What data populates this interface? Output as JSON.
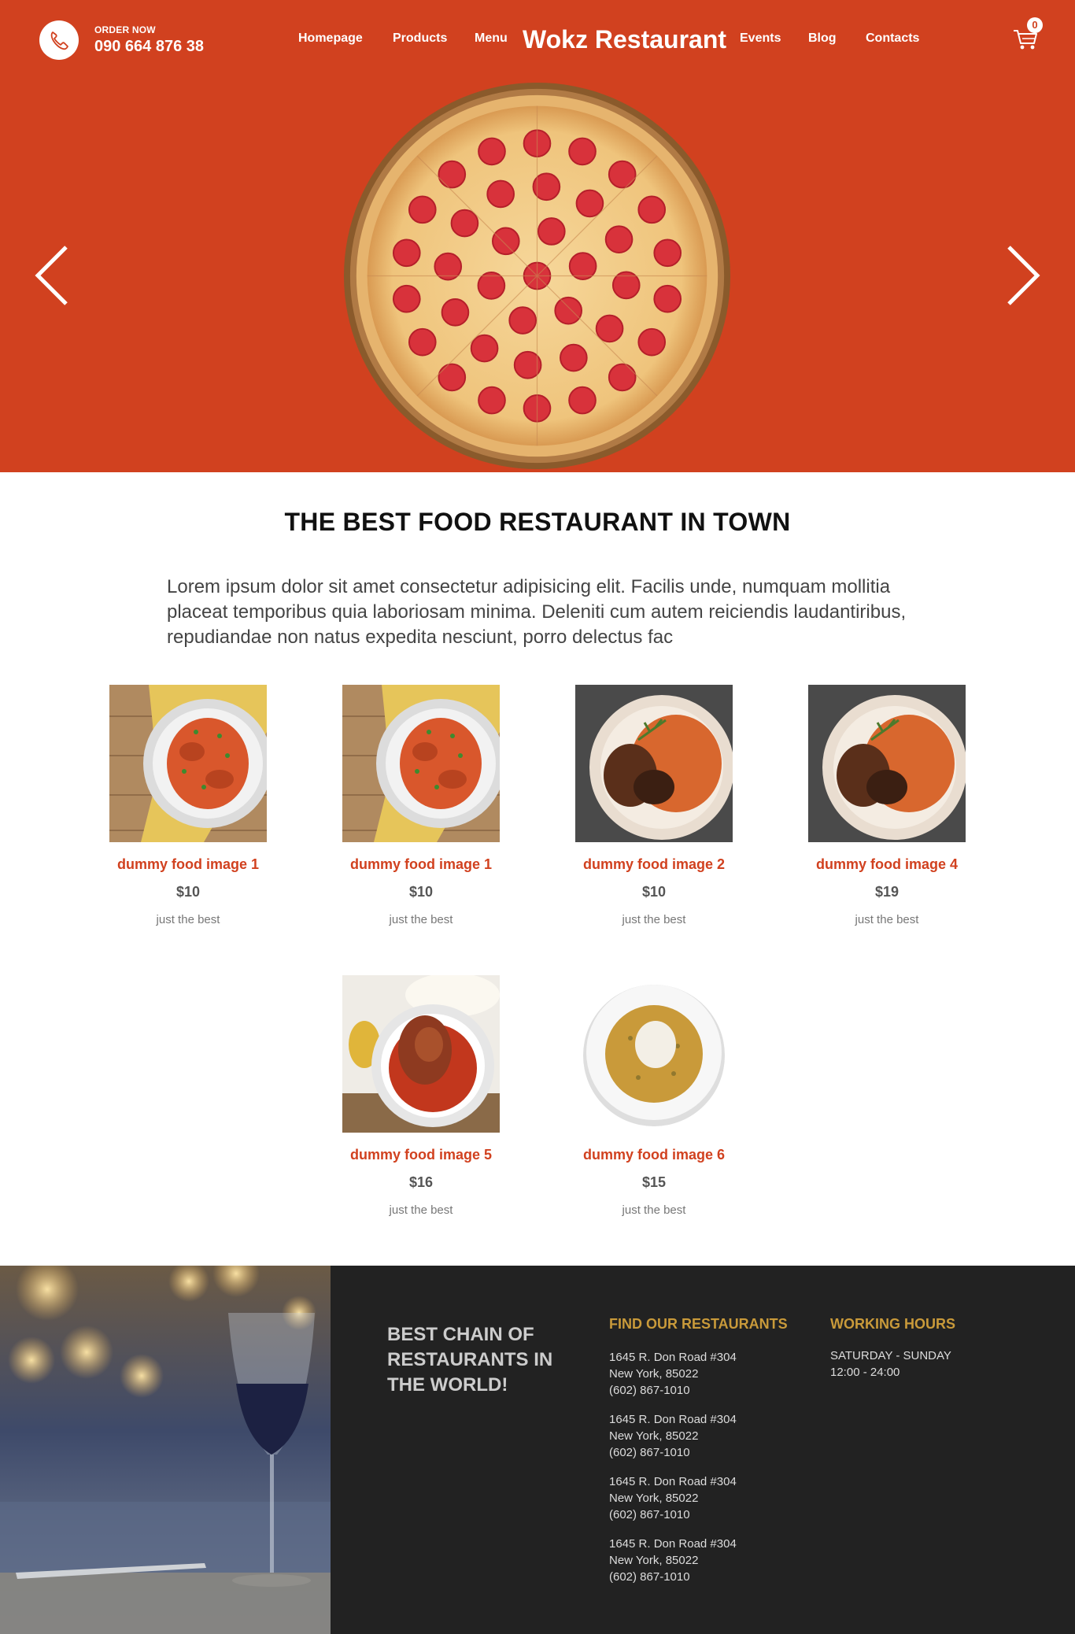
{
  "header": {
    "order_label": "ORDER NOW",
    "phone": "090 664 876 38",
    "brand": "Wokz Restaurant",
    "nav": [
      "Homepage",
      "Products",
      "Menu",
      "Events",
      "Blog",
      "Contacts"
    ],
    "cart_count": "0",
    "accent_color": "#d1411f"
  },
  "hero": {
    "image": "pepperoni-pizza",
    "prev_icon": "chevron-left-icon",
    "next_icon": "chevron-right-icon"
  },
  "intro": {
    "title": "THE BEST FOOD RESTAURANT IN TOWN",
    "text": "Lorem ipsum dolor sit amet consectetur adipisicing elit. Facilis unde, numquam mollitia placeat temporibus quia laboriosam minima. Deleniti cum autem reiciendis laudantiribus, repudiandae non natus expedita nesciunt, porro delectus fac"
  },
  "products": [
    {
      "name": "dummy food image 1",
      "price": "$10",
      "tag": "just the best",
      "image": "pasta-chicken-plate"
    },
    {
      "name": "dummy food image 1",
      "price": "$10",
      "tag": "just the best",
      "image": "pasta-chicken-plate"
    },
    {
      "name": "dummy food image 2",
      "price": "$10",
      "tag": "just the best",
      "image": "jollof-rice-chicken-bowl"
    },
    {
      "name": "dummy food image 4",
      "price": "$19",
      "tag": "just the best",
      "image": "jollof-rice-chicken-bowl"
    },
    {
      "name": "dummy food image 5",
      "price": "$16",
      "tag": "just the best",
      "image": "chicken-stew-bowl"
    },
    {
      "name": "dummy food image 6",
      "price": "$15",
      "tag": "just the best",
      "image": "egusi-soup-plate"
    }
  ],
  "footer": {
    "tagline": "BEST CHAIN OF RESTAURANTS IN THE WORLD!",
    "find_title": "FIND OUR RESTAURANTS",
    "restaurants": [
      {
        "line1": "1645 R. Don Road #304",
        "line2": "New York, 85022",
        "phone": "(602) 867-1010"
      },
      {
        "line1": "1645 R. Don Road #304",
        "line2": "New York, 85022",
        "phone": "(602) 867-1010"
      },
      {
        "line1": "1645 R. Don Road #304",
        "line2": "New York, 85022",
        "phone": "(602) 867-1010"
      },
      {
        "line1": "1645 R. Don Road #304",
        "line2": "New York, 85022",
        "phone": "(602) 867-1010"
      }
    ],
    "hours_title": "WORKING HOURS",
    "hours_days": "SATURDAY - SUNDAY",
    "hours_time": "12:00 - 24:00",
    "title_color": "#c99a3a"
  }
}
